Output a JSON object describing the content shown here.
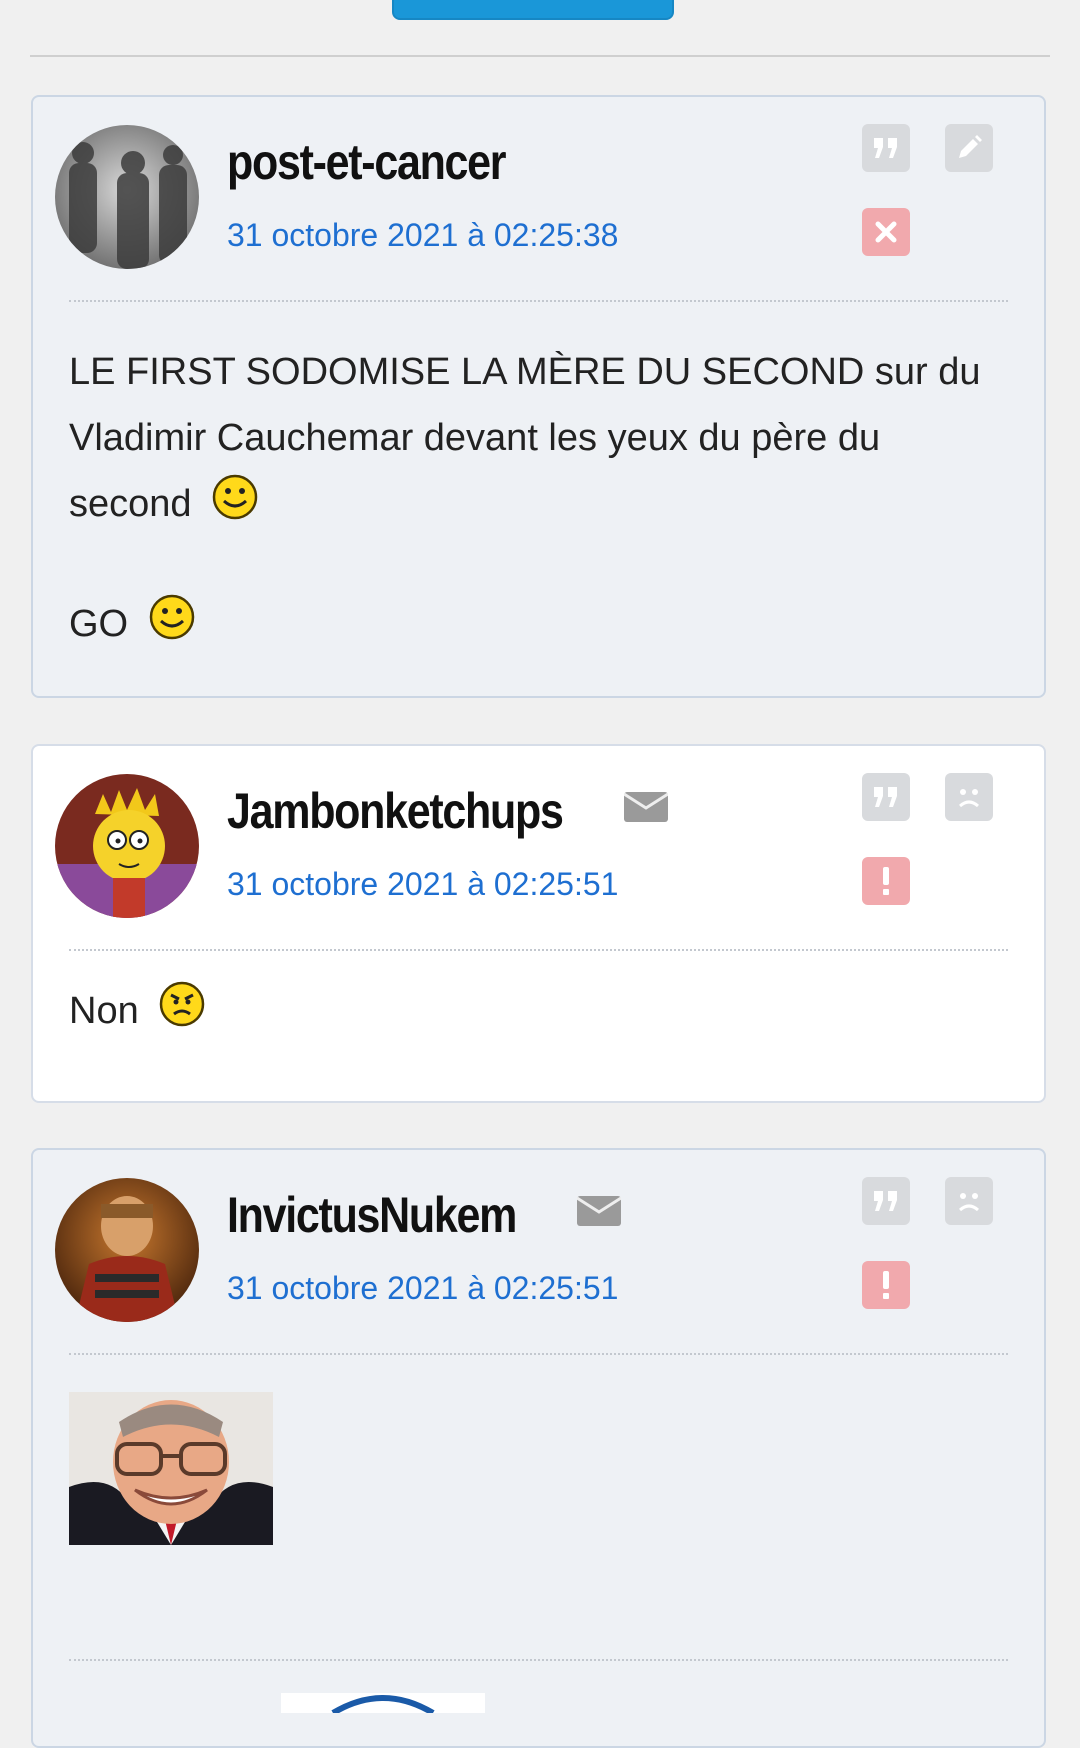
{
  "posts": [
    {
      "pseudo": "post-et-cancer",
      "date": "31 octobre 2021 à 02:25:38",
      "lines": [
        "LE FIRST SODOMISE LA MÈRE DU SECOND sur du",
        "Vladimir Cauchemar devant les yeux du père du",
        "second"
      ],
      "extra": "GO",
      "actions": [
        "quote-icon",
        "edit-icon",
        "delete-icon"
      ]
    },
    {
      "pseudo": "Jambonketchups",
      "date": "31 octobre 2021 à 02:25:51",
      "text": "Non",
      "actions": [
        "quote-icon",
        "blacklist-icon",
        "report-icon"
      ]
    },
    {
      "pseudo": "InvictusNukem",
      "date": "31 octobre 2021 à 02:25:51",
      "actions": [
        "quote-icon",
        "blacklist-icon",
        "report-icon"
      ]
    }
  ],
  "colors": {
    "accent": "#1a97d8",
    "date": "#1e6fd1",
    "report": "#f1a9ad"
  }
}
